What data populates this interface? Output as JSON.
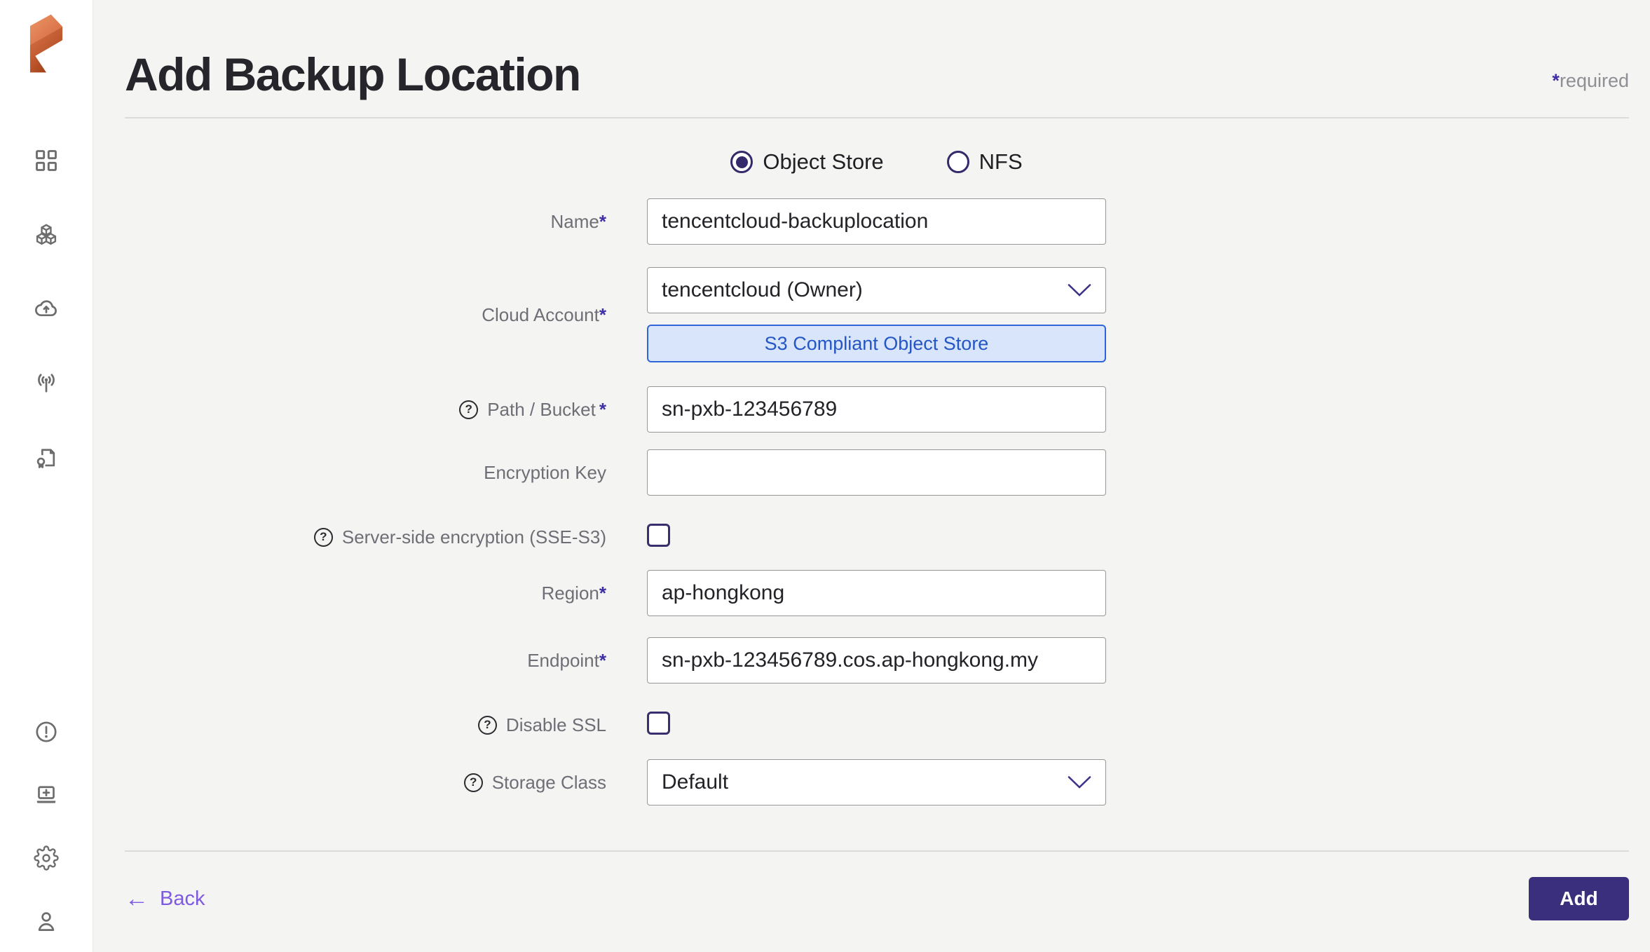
{
  "ui": {
    "required_mark": "*",
    "help_glyph": "?",
    "back_arrow": "←"
  },
  "sidebar": {
    "icons": [
      "percona-everest-logo",
      "dashboard-icon",
      "clusters-icon",
      "backups-icon",
      "monitoring-icon",
      "policies-icon",
      "alerts-icon",
      "support-icon",
      "settings-icon",
      "profile-icon"
    ]
  },
  "header": {
    "title": "Add Backup Location",
    "required_hint": "required"
  },
  "form": {
    "storage_type": {
      "options": [
        {
          "label": "Object Store",
          "selected": true
        },
        {
          "label": "NFS",
          "selected": false
        }
      ]
    },
    "fields": {
      "name": {
        "label": "Name",
        "required": true,
        "value": "tencentcloud-backuplocation"
      },
      "cloud_account": {
        "label": "Cloud Account",
        "required": true,
        "value": "tencentcloud (Owner)",
        "tag": "S3 Compliant Object Store"
      },
      "path_bucket": {
        "label": "Path / Bucket",
        "required": true,
        "has_help": true,
        "value": "sn-pxb-123456789"
      },
      "encryption_key": {
        "label": "Encryption Key",
        "required": false,
        "value": ""
      },
      "sse": {
        "label": "Server-side encryption (SSE-S3)",
        "has_help": true,
        "checked": false
      },
      "region": {
        "label": "Region",
        "required": true,
        "value": "ap-hongkong"
      },
      "endpoint": {
        "label": "Endpoint",
        "required": true,
        "value": "sn-pxb-123456789.cos.ap-hongkong.my"
      },
      "disable_ssl": {
        "label": "Disable SSL",
        "has_help": true,
        "checked": false
      },
      "storage_class": {
        "label": "Storage Class",
        "has_help": true,
        "value": "Default"
      }
    },
    "footer": {
      "back_label": "Back",
      "add_label": "Add"
    }
  },
  "colors": {
    "primary_button": "#3a2f7d",
    "link_purple": "#7e5ae2",
    "control_indigo": "#33296b",
    "tag_text_blue": "#2456c4",
    "tag_bg_blue": "#d9e5fb",
    "tag_border_blue": "#2f65d9",
    "page_bg": "#f4f4f2"
  }
}
